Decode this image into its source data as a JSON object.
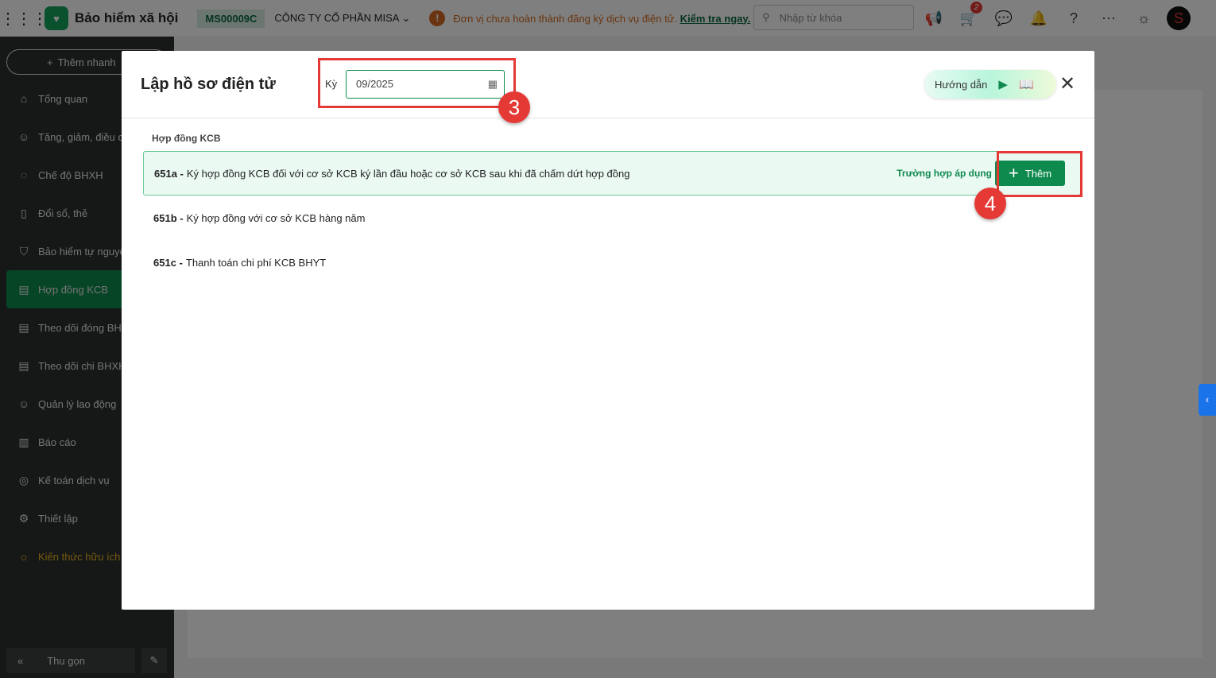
{
  "topbar": {
    "app_name": "Bảo hiểm xã hội",
    "unit_code": "MS00009C",
    "company": "CÔNG TY CỔ PHẦN MISA",
    "warning": "Đơn vị chưa hoàn thành đăng ký dịch vụ điện tử.",
    "warning_link": "Kiểm tra ngay.",
    "search_placeholder": "Nhập từ khóa",
    "cart_badge": "2"
  },
  "sidebar": {
    "quick_add": "Thêm nhanh",
    "items": [
      {
        "label": "Tổng quan",
        "icon": "home-icon"
      },
      {
        "label": "Tăng, giảm, điều chỉnh",
        "icon": "user-icon"
      },
      {
        "label": "Chế độ BHXH",
        "icon": "shield-icon"
      },
      {
        "label": "Đổi sổ, thẻ",
        "icon": "card-icon"
      },
      {
        "label": "Bảo hiểm tự nguyện",
        "icon": "shield-icon"
      },
      {
        "label": "Hợp đồng KCB",
        "icon": "contract-icon"
      },
      {
        "label": "Theo dõi đóng BHXH",
        "icon": "doc-icon"
      },
      {
        "label": "Theo dõi chi BHXH",
        "icon": "doc-icon"
      },
      {
        "label": "Quản lý lao động",
        "icon": "users-icon"
      },
      {
        "label": "Báo cáo",
        "icon": "report-icon"
      },
      {
        "label": "Kế toán dịch vụ",
        "icon": "service-icon"
      },
      {
        "label": "Thiết lập",
        "icon": "gear-icon"
      },
      {
        "label": "Kiến thức hữu ích",
        "icon": "knowledge-icon"
      }
    ],
    "collapse": "Thu gọn"
  },
  "modal": {
    "title": "Lập hồ sơ điện tử",
    "period_label": "Kỳ",
    "period_value": "09/2025",
    "guide": "Hướng dẫn",
    "section": "Hợp đồng KCB",
    "rows": [
      {
        "code": "651a -",
        "text": "Ký hợp đồng KCB đối với cơ sở KCB ký lần đầu hoặc cơ sở KCB sau khi đã chấm dứt hợp đồng",
        "case_link": "Trường hợp áp dụng",
        "add": "Thêm"
      },
      {
        "code": "651b -",
        "text": "Ký hợp đồng với cơ sở KCB hàng năm"
      },
      {
        "code": "651c -",
        "text": "Thanh toán chi phí KCB BHYT"
      }
    ]
  },
  "annotations": {
    "step3": "3",
    "step4": "4"
  },
  "colors": {
    "brand": "#0f8a4f",
    "highlight": "#e53935"
  }
}
